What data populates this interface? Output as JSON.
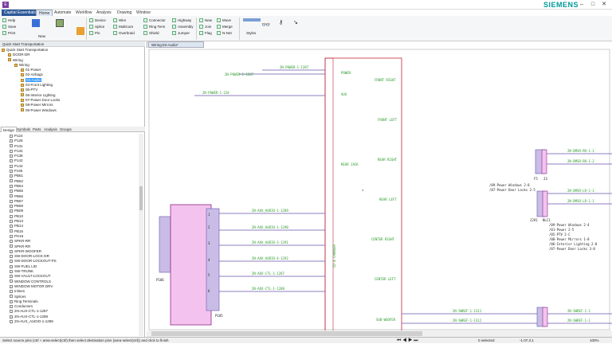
{
  "window": {
    "tab_title": "Capital Essentials",
    "brand": "SIEMENS",
    "app_icon": "E"
  },
  "menu": [
    "Capital Essentials",
    "Home",
    "Automate",
    "Workflow",
    "Analysis",
    "Drawing",
    "Window"
  ],
  "ribbon": {
    "col1": [
      "Help",
      "Save",
      "Print"
    ],
    "col1b": [
      "New"
    ],
    "col2": [
      "Device",
      "Splice",
      "Pin"
    ],
    "col3": [
      "Wire",
      "Multicore",
      "Overbraid"
    ],
    "col4": [
      "Connector",
      "Ring Term",
      "Shield"
    ],
    "col5": [
      "Highway",
      "Assembly",
      "Jumper"
    ],
    "col6": [
      "New",
      "Join",
      "Flag"
    ],
    "col7": [
      "Move",
      "Merge",
      "N-Net"
    ],
    "col8": [
      "Styles"
    ]
  },
  "leftpane": {
    "header": "Quick Start Transportation",
    "tree": [
      {
        "label": "Quick Start Transportation",
        "depth": 0
      },
      {
        "label": "DOOR-DR",
        "depth": 1
      },
      {
        "label": "Wiring",
        "depth": 1
      },
      {
        "label": "Wiring",
        "depth": 2
      },
      {
        "label": "01-Power",
        "depth": 3
      },
      {
        "label": "02-Airbags",
        "depth": 3
      },
      {
        "label": "03-Audio",
        "depth": 3,
        "selected": true
      },
      {
        "label": "04-Front Lighting",
        "depth": 3
      },
      {
        "label": "05-PTV",
        "depth": 3
      },
      {
        "label": "06-Interior Lighting",
        "depth": 3
      },
      {
        "label": "07-Power Door Locks",
        "depth": 3
      },
      {
        "label": "08-Power Mirrors",
        "depth": 3
      },
      {
        "label": "09-Power Windows",
        "depth": 3
      }
    ],
    "tabs": [
      "Design",
      "Symbols",
      "Parts",
      "Analysis",
      "Groups"
    ],
    "list": [
      "P124",
      "P128",
      "P131",
      "P132",
      "P138",
      "P142",
      "P143",
      "PJ45",
      "PB61",
      "PB62",
      "PB64",
      "PB65",
      "PB66",
      "PB67",
      "PB68",
      "PB09",
      "PB10",
      "PB13",
      "PB14",
      "PB15",
      "PH16",
      "SPKR-RR",
      "SPKR-RR",
      "SPKR-WOOFER",
      "SW-DOOR-LOCK-DR",
      "SW-DOOR-LOCKOUT-PS",
      "SW-FUEL LID",
      "SW-TRUNK",
      "SW-VAULT-LOCKOUT",
      "WINDOW CONTROLS",
      "WINDOW MOTOR DRV",
      "Inlines",
      "Splices",
      "Ring Terminals",
      "Conductors",
      "2N-AUX-CTL-1-1287",
      "2N-AUX-CTL-1-1288",
      "2N-AUX_AUDIO-1-1289"
    ]
  },
  "document": {
    "tab": "Wiring:03-Audio*"
  },
  "schematic": {
    "wire_labels_top": [
      "2N-POWER-1-1287",
      "2N-POWER-1-1287",
      "2N-POWER-1-234"
    ],
    "radio_pins": [
      "POWER",
      "AUX",
      "FRONT RIGHT",
      "FRONT LEFT",
      "REAR RIGHT",
      "REAR JACK",
      "REAR LEFT",
      "CENTER RIGHT",
      "CENTER LEFT",
      "SUB-WOOFER"
    ],
    "radio_name": "CD & CHANGER",
    "aux_wires": [
      "2N-AUX_AUDIO-1-1289",
      "2N-AUX_AUDIO-1-1290",
      "2N-AUX_AUDIO-3-1291",
      "2N-AUX_AUDIO-4-1292",
      "2N-AUX-CTL-1-1287",
      "2N-AUX-CTL-1-1288"
    ],
    "aux_pins": [
      "1",
      "2",
      "3",
      "4",
      "5",
      "6"
    ],
    "aux_name": "P105",
    "aux_left": "P106",
    "sub_wires": [
      "2N-SWREF-1-1311",
      "2N-SWREF-1-1312"
    ],
    "right_wires": [
      "2N-DMSR-RR-1-1",
      "2N-DMSR-RR-1-2",
      "2N-DMSR-LR-1-1",
      "2N-DMSR-LR-1-1"
    ],
    "right_wires_bottom": [
      "2N-SWREF-1-1",
      "2N-SWREF-1-1"
    ],
    "conn_f": "F5",
    "conn_j3": "J3",
    "conn_j291": "J291",
    "conn_lc1": "NLC1",
    "notes_left": [
      "/09-Power Windows 2-8",
      "/07-Power Door Locks 2-5"
    ],
    "notes_right": [
      "/09-Power Windows 2-4",
      "/01-Power 2-5",
      "/05-PTV 2-C",
      "/08-Power Mirrors 1-8",
      "/06-Interior Lighting 2-8",
      "/07-Power Door Locks 3-8"
    ]
  },
  "status": {
    "hint": "Select source pins (ctrl + area-select(ctrl) then select destination pins (area-select(ctrl)) and click to finish",
    "selected": "0 selected",
    "coords": "-1.07,3.1",
    "zoom": "100%"
  }
}
